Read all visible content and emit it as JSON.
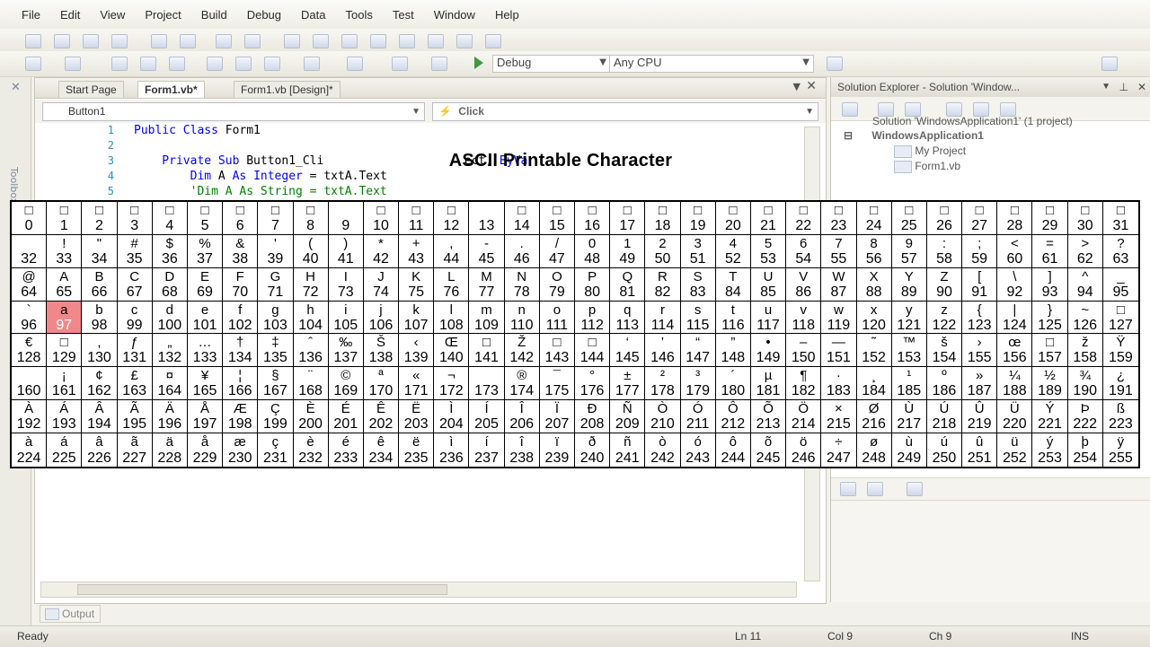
{
  "menu": [
    "File",
    "Edit",
    "View",
    "Project",
    "Build",
    "Debug",
    "Data",
    "Tools",
    "Test",
    "Window",
    "Help"
  ],
  "toolbar": {
    "config": "Debug",
    "platform": "Any CPU"
  },
  "toolbox": {
    "label": "Toolbox"
  },
  "editor": {
    "tabs": [
      "Start Page",
      "Form1.vb*",
      "Form1.vb [Design]*"
    ],
    "class_combo": "Button1",
    "method_combo": "Click",
    "code_lines": [
      {
        "n": "1",
        "parts": [
          {
            "t": "Public Class ",
            "c": "kw"
          },
          {
            "t": "Form1",
            "c": "pl"
          }
        ]
      },
      {
        "n": "2",
        "parts": []
      },
      {
        "n": "3",
        "parts": [
          {
            "t": "    Private Sub ",
            "c": "kw"
          },
          {
            "t": "Button1_Cli",
            "c": "pl"
          },
          {
            "t": "                    ect, ",
            "c": "pl"
          },
          {
            "t": "ByVa",
            "c": "kw"
          }
        ]
      },
      {
        "n": "4",
        "parts": [
          {
            "t": "        Dim ",
            "c": "kw"
          },
          {
            "t": "A ",
            "c": "pl"
          },
          {
            "t": "As ",
            "c": "kw"
          },
          {
            "t": "Integer",
            "c": "kw"
          },
          {
            "t": " = txtA.Text",
            "c": "pl"
          }
        ]
      },
      {
        "n": "5",
        "parts": [
          {
            "t": "        'Dim A As String = txtA.Text",
            "c": "cm"
          }
        ]
      }
    ]
  },
  "solution_explorer": {
    "title": "Solution Explorer - Solution 'Window...",
    "solution": "Solution 'WindowsApplication1' (1 project)",
    "project": "WindowsApplication1",
    "items": [
      "My Project",
      "Form1.vb"
    ]
  },
  "output_tab": "Output",
  "status": {
    "ready": "Ready",
    "ln": "Ln 11",
    "col": "Col 9",
    "ch": "Ch 9",
    "mode": "INS"
  },
  "ascii_table": {
    "title": "ASCII Printable Character",
    "highlight": "97",
    "cells": [
      [
        "□",
        "0"
      ],
      [
        "□",
        "1"
      ],
      [
        "□",
        "2"
      ],
      [
        "□",
        "3"
      ],
      [
        "□",
        "4"
      ],
      [
        "□",
        "5"
      ],
      [
        "□",
        "6"
      ],
      [
        "□",
        "7"
      ],
      [
        "□",
        "8"
      ],
      [
        "",
        "9"
      ],
      [
        "□",
        "10"
      ],
      [
        "□",
        "11"
      ],
      [
        "□",
        "12"
      ],
      [
        "",
        "13"
      ],
      [
        "□",
        "14"
      ],
      [
        "□",
        "15"
      ],
      [
        "□",
        "16"
      ],
      [
        "□",
        "17"
      ],
      [
        "□",
        "18"
      ],
      [
        "□",
        "19"
      ],
      [
        "□",
        "20"
      ],
      [
        "□",
        "21"
      ],
      [
        "□",
        "22"
      ],
      [
        "□",
        "23"
      ],
      [
        "□",
        "24"
      ],
      [
        "□",
        "25"
      ],
      [
        "□",
        "26"
      ],
      [
        "□",
        "27"
      ],
      [
        "□",
        "28"
      ],
      [
        "□",
        "29"
      ],
      [
        "□",
        "30"
      ],
      [
        "□",
        "31"
      ],
      [
        "",
        "32"
      ],
      [
        "!",
        "33"
      ],
      [
        "\"",
        "34"
      ],
      [
        "#",
        "35"
      ],
      [
        "$",
        "36"
      ],
      [
        "%",
        "37"
      ],
      [
        "&",
        "38"
      ],
      [
        "'",
        "39"
      ],
      [
        "(",
        "40"
      ],
      [
        ")",
        "41"
      ],
      [
        "*",
        "42"
      ],
      [
        "+",
        "43"
      ],
      [
        ",",
        "44"
      ],
      [
        "-",
        "45"
      ],
      [
        ".",
        "46"
      ],
      [
        "/",
        "47"
      ],
      [
        "0",
        "48"
      ],
      [
        "1",
        "49"
      ],
      [
        "2",
        "50"
      ],
      [
        "3",
        "51"
      ],
      [
        "4",
        "52"
      ],
      [
        "5",
        "53"
      ],
      [
        "6",
        "54"
      ],
      [
        "7",
        "55"
      ],
      [
        "8",
        "56"
      ],
      [
        "9",
        "57"
      ],
      [
        ":",
        "58"
      ],
      [
        ";",
        "59"
      ],
      [
        "<",
        "60"
      ],
      [
        "=",
        "61"
      ],
      [
        ">",
        "62"
      ],
      [
        "?",
        "63"
      ],
      [
        "@",
        "64"
      ],
      [
        "A",
        "65"
      ],
      [
        "B",
        "66"
      ],
      [
        "C",
        "67"
      ],
      [
        "D",
        "68"
      ],
      [
        "E",
        "69"
      ],
      [
        "F",
        "70"
      ],
      [
        "G",
        "71"
      ],
      [
        "H",
        "72"
      ],
      [
        "I",
        "73"
      ],
      [
        "J",
        "74"
      ],
      [
        "K",
        "75"
      ],
      [
        "L",
        "76"
      ],
      [
        "M",
        "77"
      ],
      [
        "N",
        "78"
      ],
      [
        "O",
        "79"
      ],
      [
        "P",
        "80"
      ],
      [
        "Q",
        "81"
      ],
      [
        "R",
        "82"
      ],
      [
        "S",
        "83"
      ],
      [
        "T",
        "84"
      ],
      [
        "U",
        "85"
      ],
      [
        "V",
        "86"
      ],
      [
        "W",
        "87"
      ],
      [
        "X",
        "88"
      ],
      [
        "Y",
        "89"
      ],
      [
        "Z",
        "90"
      ],
      [
        "[",
        "91"
      ],
      [
        "\\",
        "92"
      ],
      [
        "]",
        "93"
      ],
      [
        "^",
        "94"
      ],
      [
        "_",
        "95"
      ],
      [
        "`",
        "96"
      ],
      [
        "a",
        "97"
      ],
      [
        "b",
        "98"
      ],
      [
        "c",
        "99"
      ],
      [
        "d",
        "100"
      ],
      [
        "e",
        "101"
      ],
      [
        "f",
        "102"
      ],
      [
        "g",
        "103"
      ],
      [
        "h",
        "104"
      ],
      [
        "i",
        "105"
      ],
      [
        "j",
        "106"
      ],
      [
        "k",
        "107"
      ],
      [
        "l",
        "108"
      ],
      [
        "m",
        "109"
      ],
      [
        "n",
        "110"
      ],
      [
        "o",
        "111"
      ],
      [
        "p",
        "112"
      ],
      [
        "q",
        "113"
      ],
      [
        "r",
        "114"
      ],
      [
        "s",
        "115"
      ],
      [
        "t",
        "116"
      ],
      [
        "u",
        "117"
      ],
      [
        "v",
        "118"
      ],
      [
        "w",
        "119"
      ],
      [
        "x",
        "120"
      ],
      [
        "y",
        "121"
      ],
      [
        "z",
        "122"
      ],
      [
        "{",
        "123"
      ],
      [
        "|",
        "124"
      ],
      [
        "}",
        "125"
      ],
      [
        "~",
        "126"
      ],
      [
        "□",
        "127"
      ],
      [
        "€",
        "128"
      ],
      [
        "□",
        "129"
      ],
      [
        "‚",
        "130"
      ],
      [
        "ƒ",
        "131"
      ],
      [
        "„",
        "132"
      ],
      [
        "…",
        "133"
      ],
      [
        "†",
        "134"
      ],
      [
        "‡",
        "135"
      ],
      [
        "ˆ",
        "136"
      ],
      [
        "‰",
        "137"
      ],
      [
        "Š",
        "138"
      ],
      [
        "‹",
        "139"
      ],
      [
        "Œ",
        "140"
      ],
      [
        "□",
        "141"
      ],
      [
        "Ž",
        "142"
      ],
      [
        "□",
        "143"
      ],
      [
        "□",
        "144"
      ],
      [
        "‘",
        "145"
      ],
      [
        "’",
        "146"
      ],
      [
        "“",
        "147"
      ],
      [
        "”",
        "148"
      ],
      [
        "•",
        "149"
      ],
      [
        "–",
        "150"
      ],
      [
        "—",
        "151"
      ],
      [
        "˜",
        "152"
      ],
      [
        "™",
        "153"
      ],
      [
        "š",
        "154"
      ],
      [
        "›",
        "155"
      ],
      [
        "œ",
        "156"
      ],
      [
        "□",
        "157"
      ],
      [
        "ž",
        "158"
      ],
      [
        "Ÿ",
        "159"
      ],
      [
        "",
        "160"
      ],
      [
        "¡",
        "161"
      ],
      [
        "¢",
        "162"
      ],
      [
        "£",
        "163"
      ],
      [
        "¤",
        "164"
      ],
      [
        "¥",
        "165"
      ],
      [
        "¦",
        "166"
      ],
      [
        "§",
        "167"
      ],
      [
        "¨",
        "168"
      ],
      [
        "©",
        "169"
      ],
      [
        "ª",
        "170"
      ],
      [
        "«",
        "171"
      ],
      [
        "¬",
        "172"
      ],
      [
        "",
        "173"
      ],
      [
        "®",
        "174"
      ],
      [
        "¯",
        "175"
      ],
      [
        "°",
        "176"
      ],
      [
        "±",
        "177"
      ],
      [
        "²",
        "178"
      ],
      [
        "³",
        "179"
      ],
      [
        "´",
        "180"
      ],
      [
        "µ",
        "181"
      ],
      [
        "¶",
        "182"
      ],
      [
        "·",
        "183"
      ],
      [
        "¸",
        "184"
      ],
      [
        "¹",
        "185"
      ],
      [
        "º",
        "186"
      ],
      [
        "»",
        "187"
      ],
      [
        "¼",
        "188"
      ],
      [
        "½",
        "189"
      ],
      [
        "¾",
        "190"
      ],
      [
        "¿",
        "191"
      ],
      [
        "À",
        "192"
      ],
      [
        "Á",
        "193"
      ],
      [
        "Â",
        "194"
      ],
      [
        "Ã",
        "195"
      ],
      [
        "Ä",
        "196"
      ],
      [
        "Å",
        "197"
      ],
      [
        "Æ",
        "198"
      ],
      [
        "Ç",
        "199"
      ],
      [
        "È",
        "200"
      ],
      [
        "É",
        "201"
      ],
      [
        "Ê",
        "202"
      ],
      [
        "Ë",
        "203"
      ],
      [
        "Ì",
        "204"
      ],
      [
        "Í",
        "205"
      ],
      [
        "Î",
        "206"
      ],
      [
        "Ï",
        "207"
      ],
      [
        "Ð",
        "208"
      ],
      [
        "Ñ",
        "209"
      ],
      [
        "Ò",
        "210"
      ],
      [
        "Ó",
        "211"
      ],
      [
        "Ô",
        "212"
      ],
      [
        "Õ",
        "213"
      ],
      [
        "Ö",
        "214"
      ],
      [
        "×",
        "215"
      ],
      [
        "Ø",
        "216"
      ],
      [
        "Ù",
        "217"
      ],
      [
        "Ú",
        "218"
      ],
      [
        "Û",
        "219"
      ],
      [
        "Ü",
        "220"
      ],
      [
        "Ý",
        "221"
      ],
      [
        "Þ",
        "222"
      ],
      [
        "ß",
        "223"
      ],
      [
        "à",
        "224"
      ],
      [
        "á",
        "225"
      ],
      [
        "â",
        "226"
      ],
      [
        "ã",
        "227"
      ],
      [
        "ä",
        "228"
      ],
      [
        "å",
        "229"
      ],
      [
        "æ",
        "230"
      ],
      [
        "ç",
        "231"
      ],
      [
        "è",
        "232"
      ],
      [
        "é",
        "233"
      ],
      [
        "ê",
        "234"
      ],
      [
        "ë",
        "235"
      ],
      [
        "ì",
        "236"
      ],
      [
        "í",
        "237"
      ],
      [
        "î",
        "238"
      ],
      [
        "ï",
        "239"
      ],
      [
        "ð",
        "240"
      ],
      [
        "ñ",
        "241"
      ],
      [
        "ò",
        "242"
      ],
      [
        "ó",
        "243"
      ],
      [
        "ô",
        "244"
      ],
      [
        "õ",
        "245"
      ],
      [
        "ö",
        "246"
      ],
      [
        "÷",
        "247"
      ],
      [
        "ø",
        "248"
      ],
      [
        "ù",
        "249"
      ],
      [
        "ú",
        "250"
      ],
      [
        "û",
        "251"
      ],
      [
        "ü",
        "252"
      ],
      [
        "ý",
        "253"
      ],
      [
        "þ",
        "254"
      ],
      [
        "ÿ",
        "255"
      ]
    ]
  }
}
